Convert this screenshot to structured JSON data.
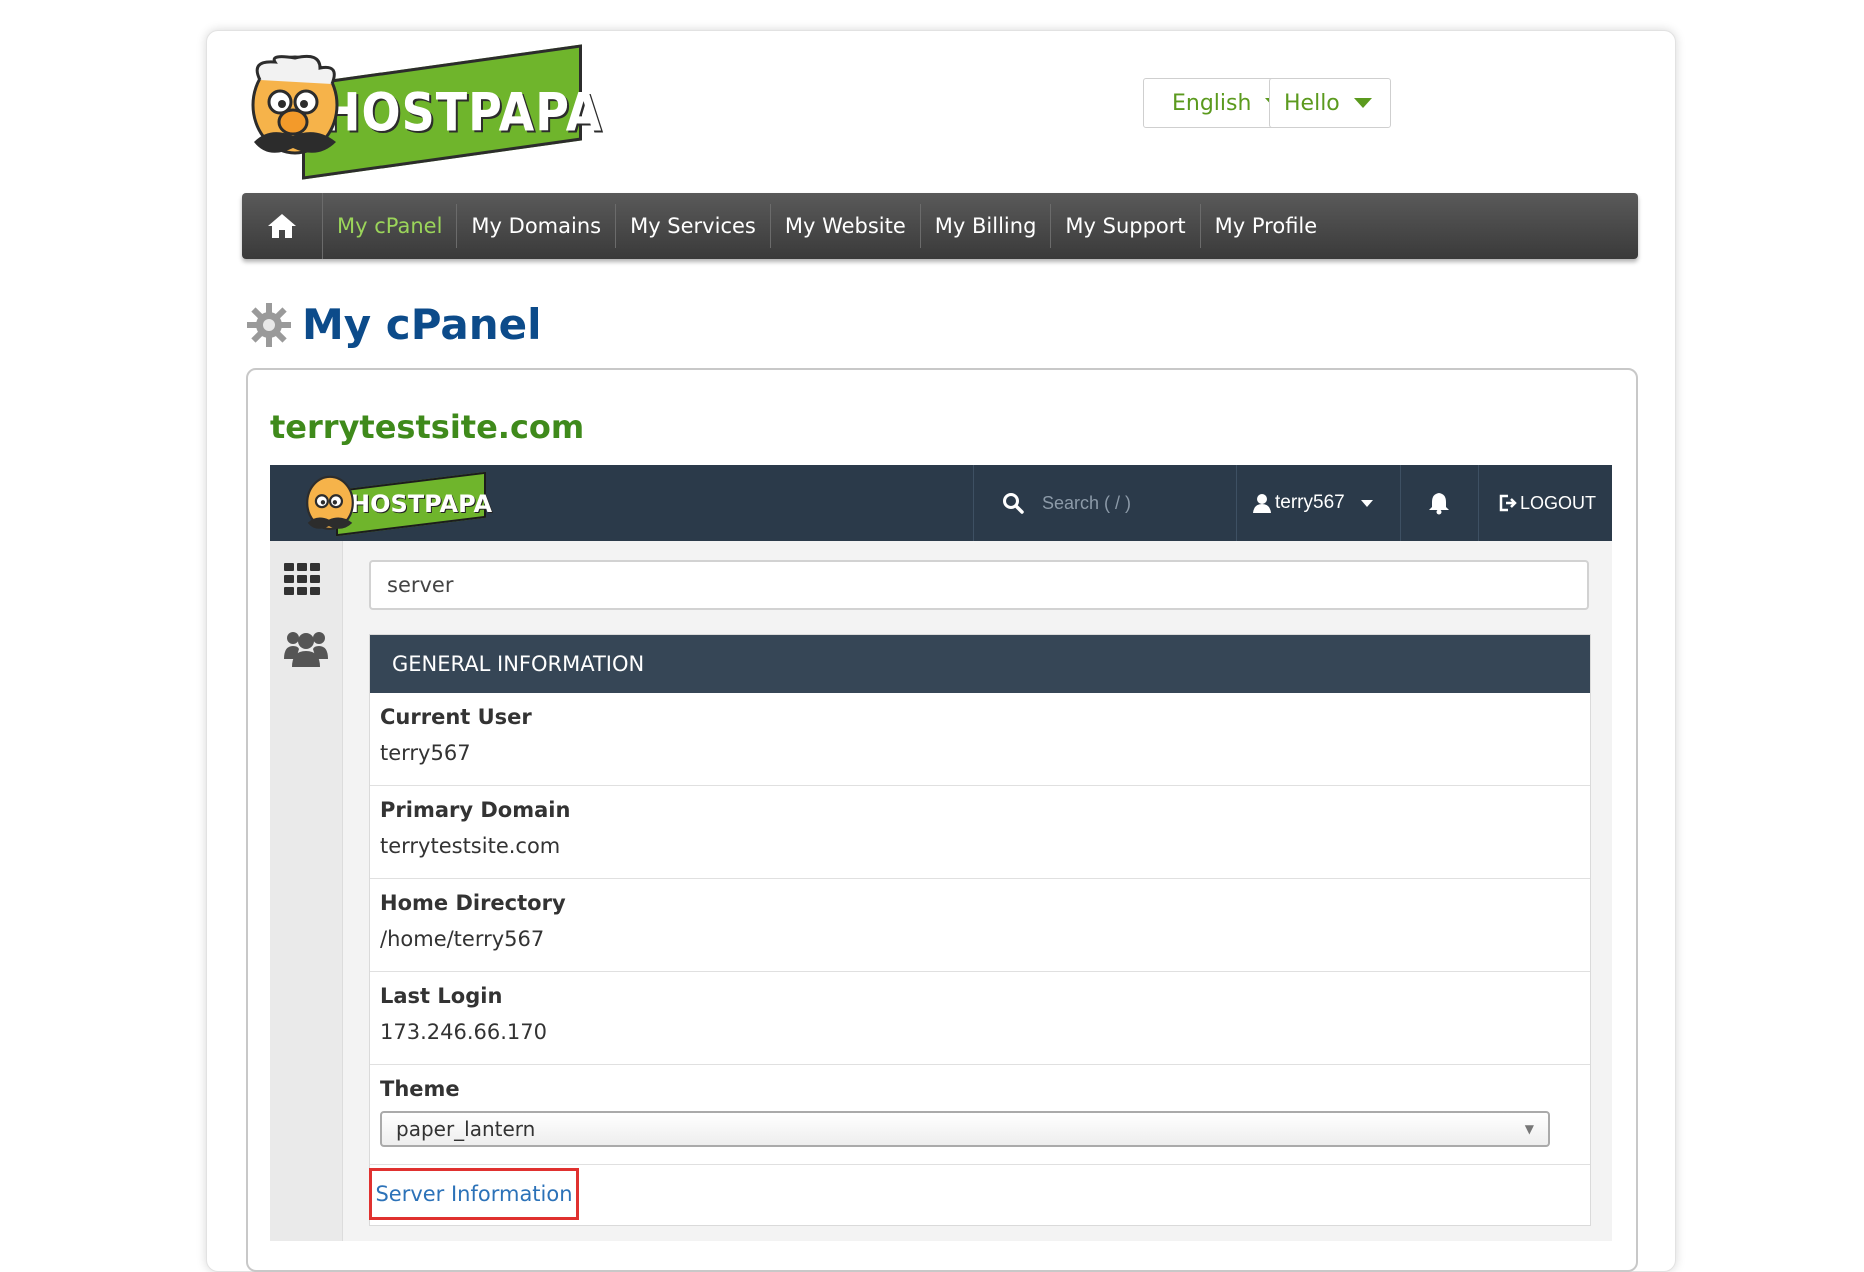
{
  "brand": {
    "name": "HOSTPAPA",
    "green": "#6fb52c"
  },
  "header": {
    "language_label": "English",
    "greeting_label": "Hello"
  },
  "nav": {
    "items": [
      {
        "label": "My cPanel",
        "active": true
      },
      {
        "label": "My Domains"
      },
      {
        "label": "My Services"
      },
      {
        "label": "My Website"
      },
      {
        "label": "My Billing"
      },
      {
        "label": "My Support"
      },
      {
        "label": "My Profile"
      }
    ]
  },
  "page": {
    "title": "My cPanel",
    "domain": "terrytestsite.com"
  },
  "cpanel": {
    "logo_text": "HOSTPAPA",
    "search_placeholder": "Search ( / )",
    "username": "terry567",
    "logout_label": "LOGOUT",
    "filter_value": "server",
    "section_title": "GENERAL INFORMATION",
    "info": [
      {
        "label": "Current User",
        "value": "terry567"
      },
      {
        "label": "Primary Domain",
        "value": "terrytestsite.com"
      },
      {
        "label": "Home Directory",
        "value": "/home/terry567"
      },
      {
        "label": "Last Login",
        "value": "173.246.66.170"
      }
    ],
    "theme": {
      "label": "Theme",
      "value": "paper_lantern"
    },
    "server_info_link": "Server Information"
  }
}
